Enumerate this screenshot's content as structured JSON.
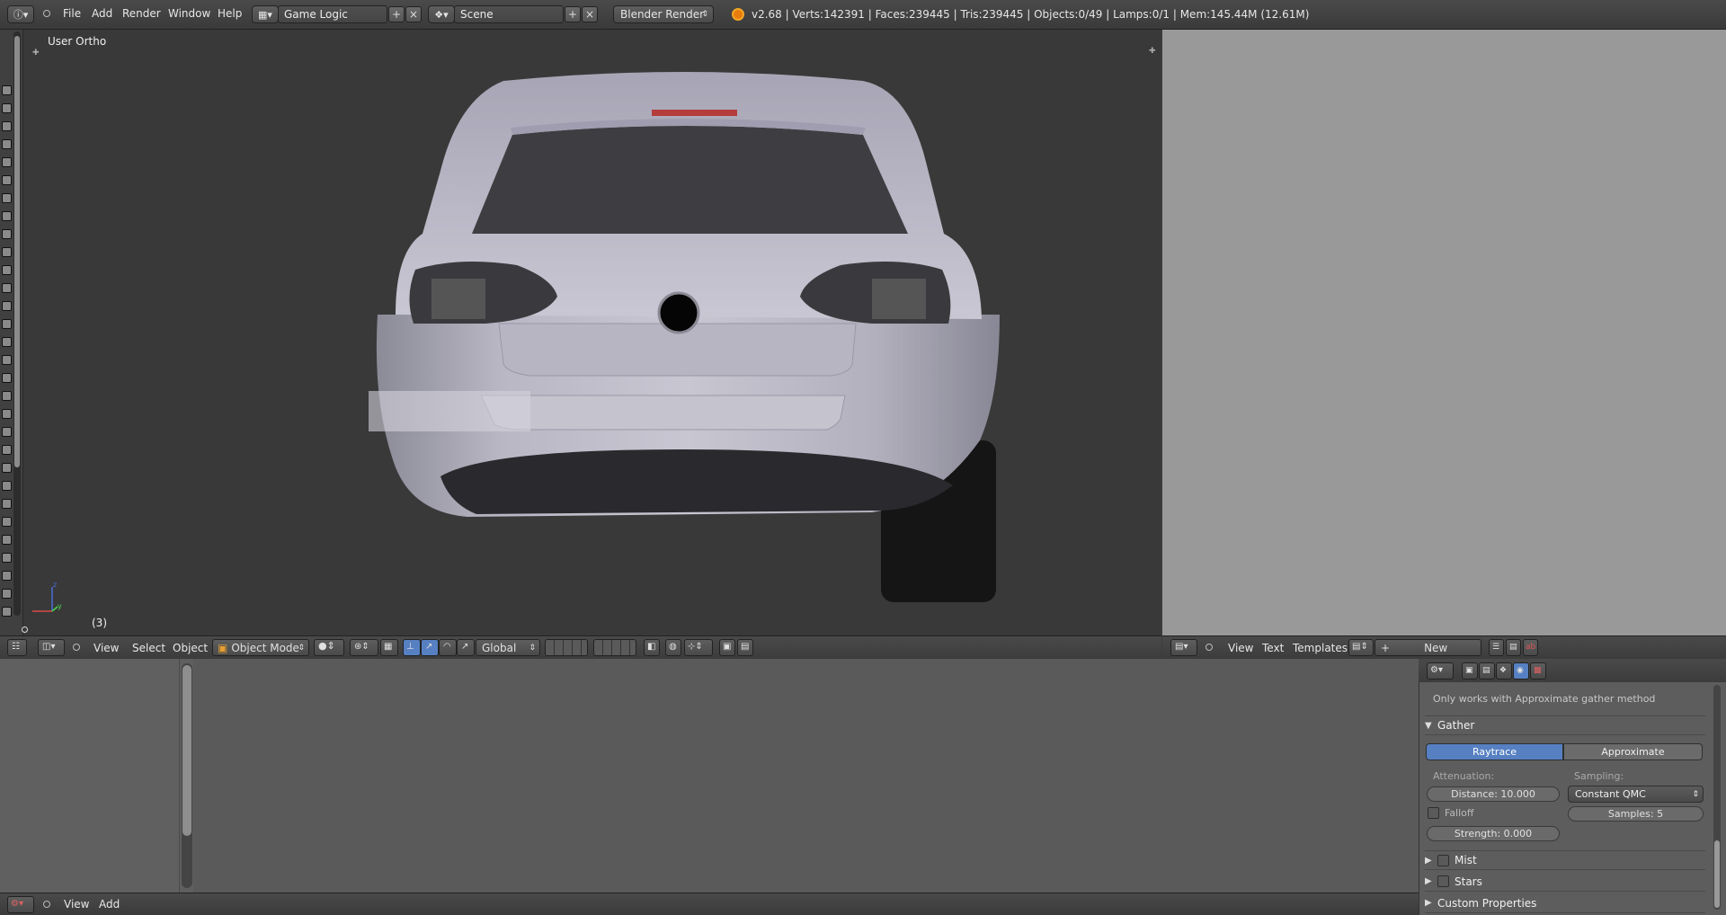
{
  "topbar": {
    "menus": [
      "File",
      "Add",
      "Render",
      "Window",
      "Help"
    ],
    "screen_layout": "Game Logic",
    "scene": "Scene",
    "render_engine": "Blender Render",
    "stats": "v2.68 | Verts:142391 | Faces:239445 | Tris:239445 | Objects:0/49 | Lamps:0/1 | Mem:145.44M (12.61M)"
  },
  "viewport": {
    "view_label": "User Ortho",
    "frame_label": "(3)",
    "header_menus": [
      "View",
      "Select",
      "Object"
    ],
    "mode": "Object Mode",
    "orientation": "Global"
  },
  "text_editor": {
    "header_menus": [
      "View",
      "Text",
      "Templates"
    ],
    "new_button": "New"
  },
  "logic_editor": {
    "header_menus": [
      "View",
      "Add"
    ]
  },
  "properties": {
    "note": "Only works with Approximate gather method",
    "gather": {
      "title": "Gather",
      "tab_raytrace": "Raytrace",
      "tab_approximate": "Approximate",
      "attenuation_label": "Attenuation:",
      "sampling_label": "Sampling:",
      "distance": "Distance: 10.000",
      "sampling_method": "Constant QMC",
      "falloff": "Falloff",
      "samples": "Samples: 5",
      "strength": "Strength: 0.000"
    },
    "sections": [
      "Mist",
      "Stars",
      "Custom Properties"
    ]
  },
  "colors": {
    "accent_blue": "#5680c2",
    "viewport_bg": "#393939",
    "text_editor_bg": "#999999"
  }
}
